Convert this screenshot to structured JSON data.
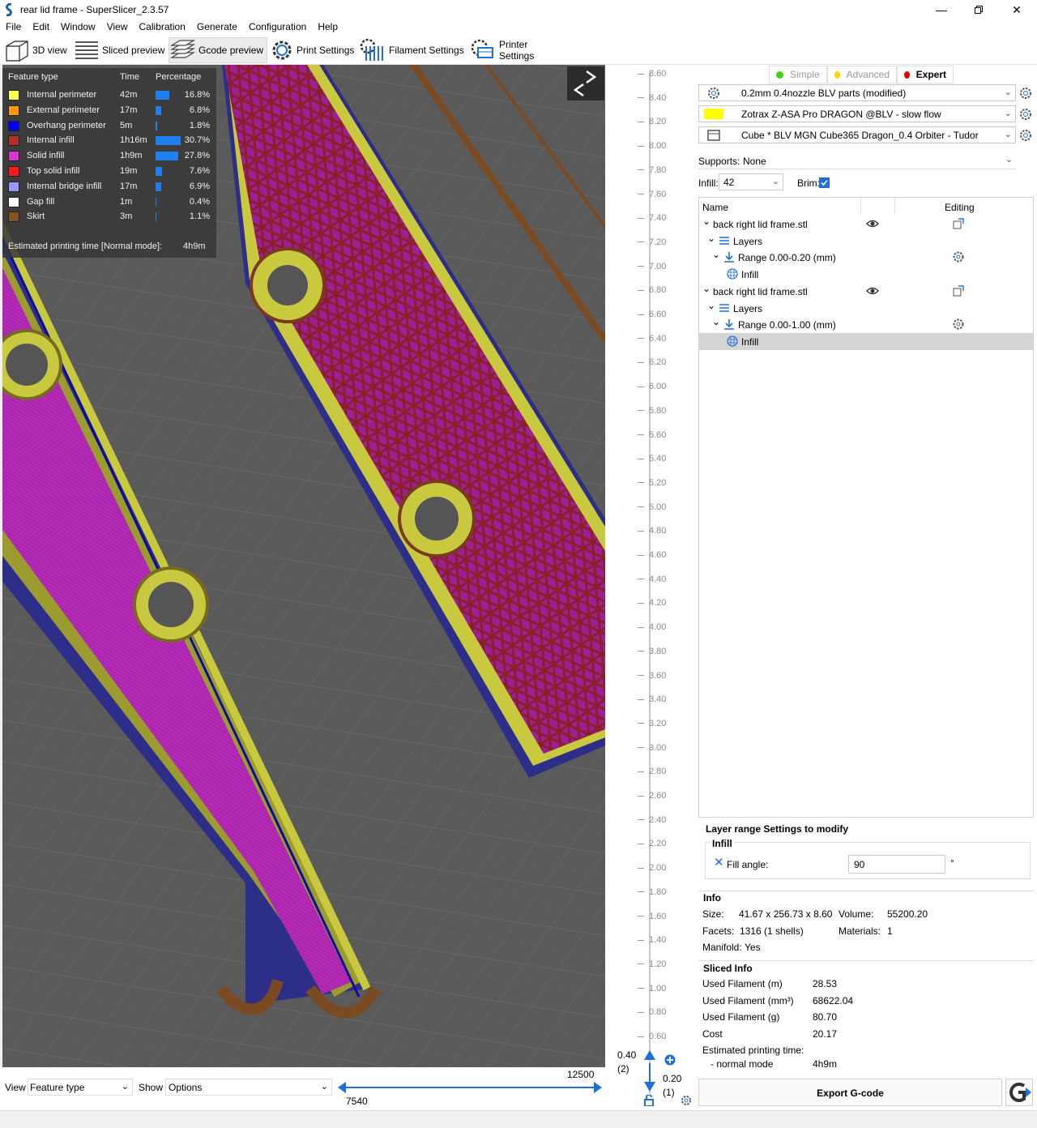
{
  "window": {
    "title": "rear lid frame - SuperSlicer_2.3.57",
    "controls": [
      "minimize-icon",
      "restore-icon",
      "close-icon"
    ]
  },
  "menu": [
    "File",
    "Edit",
    "Window",
    "View",
    "Calibration",
    "Generate",
    "Configuration",
    "Help"
  ],
  "tabs": [
    {
      "label": "3D view",
      "icon": "cube-icon",
      "active": false
    },
    {
      "label": "Sliced preview",
      "icon": "layers-icon",
      "active": false
    },
    {
      "label": "Gcode preview",
      "icon": "stack-icon",
      "active": true
    },
    {
      "label": "Print Settings",
      "icon": "gear-icon",
      "active": false
    },
    {
      "label": "Filament Settings",
      "icon": "spool-icon",
      "active": false
    },
    {
      "label": "Printer Settings",
      "icon": "printer-icon",
      "active": false
    }
  ],
  "legend": {
    "headers": {
      "feature": "Feature type",
      "time": "Time",
      "percentage": "Percentage"
    },
    "rows": [
      {
        "label": "Internal perimeter",
        "time": "42m",
        "pct": "16.8%",
        "frac": 0.168,
        "color": "#ffff4c"
      },
      {
        "label": "External perimeter",
        "time": "17m",
        "pct": "6.8%",
        "frac": 0.068,
        "color": "#ff9a00"
      },
      {
        "label": "Overhang perimeter",
        "time": "5m",
        "pct": "1.8%",
        "frac": 0.018,
        "color": "#0000ff"
      },
      {
        "label": "Internal infill",
        "time": "1h16m",
        "pct": "30.7%",
        "frac": 0.307,
        "color": "#b03029"
      },
      {
        "label": "Solid infill",
        "time": "1h9m",
        "pct": "27.8%",
        "frac": 0.278,
        "color": "#d735d0"
      },
      {
        "label": "Top solid infill",
        "time": "19m",
        "pct": "7.6%",
        "frac": 0.076,
        "color": "#ff1a1a"
      },
      {
        "label": "Internal bridge infill",
        "time": "17m",
        "pct": "6.9%",
        "frac": 0.069,
        "color": "#9999ff"
      },
      {
        "label": "Gap fill",
        "time": "1m",
        "pct": "0.4%",
        "frac": 0.004,
        "color": "#ffffff"
      },
      {
        "label": "Skirt",
        "time": "3m",
        "pct": "1.1%",
        "frac": 0.011,
        "color": "#845321"
      }
    ],
    "estimated_label": "Estimated printing time [Normal mode]:",
    "estimated_value": "4h9m"
  },
  "layer_slider": {
    "ticks": [
      "8.60",
      "8.40",
      "8.20",
      "8.00",
      "7.80",
      "7.60",
      "7.40",
      "7.20",
      "7.00",
      "6.80",
      "6.60",
      "6.40",
      "6.20",
      "6.00",
      "5.80",
      "5.60",
      "5.40",
      "5.20",
      "5.00",
      "4.80",
      "4.60",
      "4.40",
      "4.20",
      "4.00",
      "3.80",
      "3.60",
      "3.40",
      "3.20",
      "3.00",
      "2.80",
      "2.60",
      "2.40",
      "2.20",
      "2.00",
      "1.80",
      "1.60",
      "1.40",
      "1.20",
      "1.00",
      "0.80",
      "0.60"
    ],
    "upper_value": "0.40",
    "upper_index": "(2)",
    "lower_value": "0.20",
    "lower_index": "(1)"
  },
  "bottom": {
    "view_label": "View",
    "view_value": "Feature type",
    "show_label": "Show",
    "show_value": "Options",
    "h_slider_max": "12500",
    "h_slider_min": "7540"
  },
  "right_panel": {
    "modes": [
      {
        "label": "Simple",
        "color": "#44d313"
      },
      {
        "label": "Advanced",
        "color": "#ffd700"
      },
      {
        "label": "Expert",
        "color": "#e60000"
      }
    ],
    "print_preset": "0.2mm 0.4nozzle BLV parts (modified)",
    "filament_preset": "Zotrax Z-ASA Pro DRAGON @BLV - slow flow",
    "filament_color": "#ffff00",
    "printer_preset": "Cube * BLV MGN Cube365 Dragon_0.4 Orbiter - Tudor",
    "supports_label": "Supports:",
    "supports_value": "None",
    "infill_label": "Infill:",
    "infill_value": "42",
    "brim_label": "Brim:",
    "tree": {
      "col_name": "Name",
      "col_editing": "Editing",
      "rows": [
        {
          "label": "back right lid frame.stl",
          "level": 0,
          "eye": true,
          "edit": "edit-icon"
        },
        {
          "label": "Layers",
          "level": 1
        },
        {
          "label": "Range 0.00-0.20 (mm)",
          "level": 2,
          "edit": "gear-icon"
        },
        {
          "label": "Infill",
          "level": 3
        },
        {
          "label": "back right lid frame.stl",
          "level": 0,
          "eye": true,
          "edit": "edit-icon"
        },
        {
          "label": "Layers",
          "level": 1
        },
        {
          "label": "Range 0.00-1.00 (mm)",
          "level": 2,
          "edit": "gear-icon"
        },
        {
          "label": "Infill",
          "level": 3,
          "selected": true
        }
      ]
    },
    "layer_settings": {
      "title": "Layer range Settings to modify",
      "group": "Infill",
      "field_label": "Fill angle:",
      "field_value": "90",
      "unit": "°"
    },
    "info": {
      "title": "Info",
      "size_label": "Size:",
      "size_value": "41.67 x 256.73 x 8.60",
      "volume_label": "Volume:",
      "volume_value": "55200.20",
      "facets_label": "Facets:",
      "facets_value": "1316 (1 shells)",
      "materials_label": "Materials:",
      "materials_value": "1",
      "manifold_label": "Manifold:",
      "manifold_value": "Yes"
    },
    "sliced_info": {
      "title": "Sliced Info",
      "rows": [
        {
          "label": "Used Filament (m)",
          "value": "28.53"
        },
        {
          "label": "Used Filament (mm³)",
          "value": "68622.04"
        },
        {
          "label": "Used Filament (g)",
          "value": "80.70"
        },
        {
          "label": "Cost",
          "value": "20.17"
        }
      ],
      "est_label": "Estimated printing time:",
      "mode_label": "- normal mode",
      "mode_value": "4h9m"
    },
    "export_label": "Export G-code"
  }
}
